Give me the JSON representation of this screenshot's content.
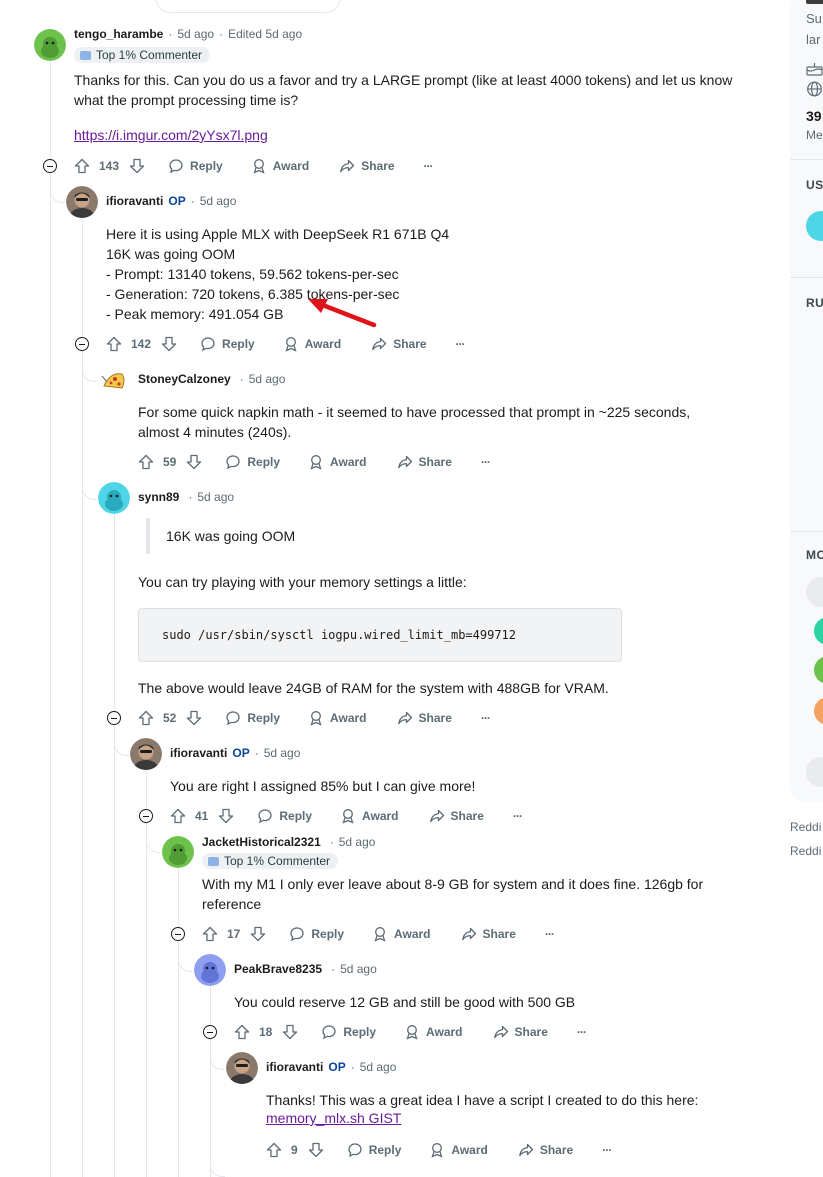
{
  "comments": [
    {
      "user": "tengo_harambe",
      "op": "",
      "age": "5d ago",
      "edited": "Edited 5d ago",
      "flair": "Top 1% Commenter",
      "lines": [
        "Thanks for this. Can you do us a favor and try a LARGE prompt (like at least 4000 tokens) and let us know",
        "what the prompt processing time is?"
      ],
      "link": "https://i.imgur.com/2yYsx7l.png",
      "votes": "143"
    },
    {
      "user": "ifioravanti",
      "op": "OP",
      "age": "5d ago",
      "lines": [
        "Here it is using Apple MLX with DeepSeek R1 671B Q4",
        "16K was going OOM",
        "- Prompt: 13140 tokens, 59.562 tokens-per-sec",
        "- Generation: 720 tokens, 6.385 tokens-per-sec",
        "- Peak memory: 491.054 GB"
      ],
      "votes": "142"
    },
    {
      "user": "StoneyCalzoney",
      "op": "",
      "age": "5d ago",
      "lines": [
        "For some quick napkin math - it seemed to have processed that prompt in ~225 seconds,",
        "almost 4 minutes (240s)."
      ],
      "votes": "59"
    },
    {
      "user": "synn89",
      "op": "",
      "age": "5d ago",
      "quote": "16K was going OOM",
      "line1": "You can try playing with your memory settings a little:",
      "code": "sudo /usr/sbin/sysctl iogpu.wired_limit_mb=499712",
      "line2": "The above would leave 24GB of RAM for the system with 488GB for VRAM.",
      "votes": "52"
    },
    {
      "user": "ifioravanti",
      "op": "OP",
      "age": "5d ago",
      "lines": [
        "You are right I assigned 85% but I can give more!"
      ],
      "votes": "41"
    },
    {
      "user": "JacketHistorical2321",
      "op": "",
      "age": "5d ago",
      "flair": "Top 1% Commenter",
      "lines": [
        "With my M1 I only ever leave about 8-9 GB for system and it does fine. 126gb for",
        "reference"
      ],
      "votes": "17"
    },
    {
      "user": "PeakBrave8235",
      "op": "",
      "age": "5d ago",
      "lines": [
        "You could reserve 12 GB and still be good with 500 GB"
      ],
      "votes": "18"
    },
    {
      "user": "ifioravanti",
      "op": "OP",
      "age": "5d ago",
      "lines": [
        "Thanks! This was a great idea I have a script I created to do this here:"
      ],
      "link": "memory_mlx.sh GIST",
      "votes": "9"
    }
  ],
  "actions": {
    "reply": "Reply",
    "award": "Award",
    "share": "Share",
    "more": "···"
  },
  "sidebar": {
    "frag1": "Su",
    "frag2": "lar",
    "count": "39",
    "frag3": "Me",
    "h1": "US",
    "h2": "RU",
    "h3": "MO",
    "foot1": "Reddi",
    "foot2": "Reddi"
  },
  "colors": {
    "upvote_gray": "#5c6c74",
    "link_purple": "#6a1b9a",
    "op_blue": "#0a449b",
    "annotation_arrow": "#e0131b"
  }
}
